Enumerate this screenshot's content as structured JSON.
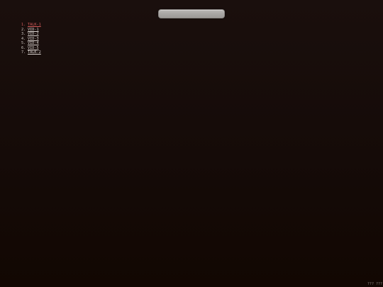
{
  "top_bar": {
    "text": ""
  },
  "items": [
    {
      "num": "1.",
      "label": "TALK-1",
      "selected": true
    },
    {
      "num": "2.",
      "label": "VID-1",
      "selected": false
    },
    {
      "num": "3.",
      "label": "VID-2",
      "selected": false
    },
    {
      "num": "4.",
      "label": "VID-3",
      "selected": false
    },
    {
      "num": "5.",
      "label": "VID-4",
      "selected": false
    },
    {
      "num": "6.",
      "label": "VID-5",
      "selected": false
    },
    {
      "num": "7.",
      "label": "TALK-2",
      "selected": false
    }
  ],
  "corner": {
    "text": "??? ???"
  },
  "colors": {
    "background": "#150b08",
    "selected_text": "#d25a5a",
    "text": "#d8d2ce",
    "bar": "#a9a6a4"
  }
}
